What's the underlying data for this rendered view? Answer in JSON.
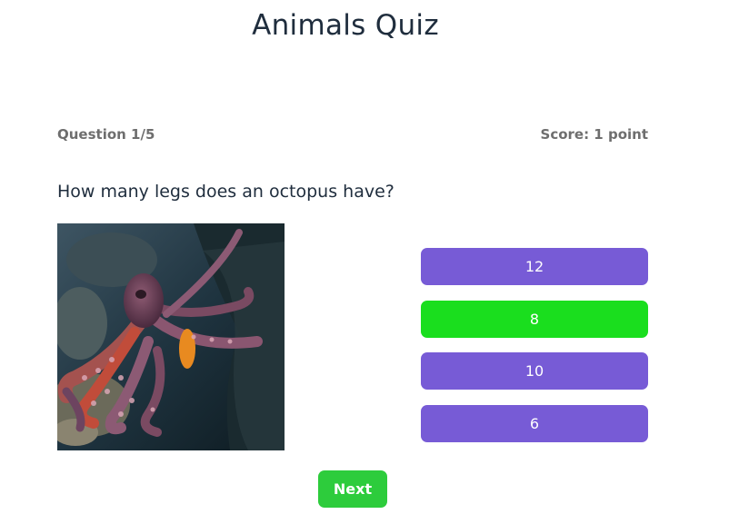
{
  "quiz": {
    "title": "Animals Quiz",
    "progress_label": "Question 1/5",
    "score_label": "Score: 1 point",
    "question": "How many legs does an octopus have?",
    "answers": [
      {
        "label": "12",
        "state": "default"
      },
      {
        "label": "8",
        "state": "correct"
      },
      {
        "label": "10",
        "state": "default"
      },
      {
        "label": "6",
        "state": "default"
      }
    ],
    "next_label": "Next"
  },
  "colors": {
    "answer_default": "#775bd6",
    "answer_correct": "#1ade1e",
    "next_button": "#2dcc3c",
    "title_text": "#1f2d3d",
    "meta_text": "#6e6e6e"
  },
  "image": {
    "subject": "octopus-photo"
  }
}
